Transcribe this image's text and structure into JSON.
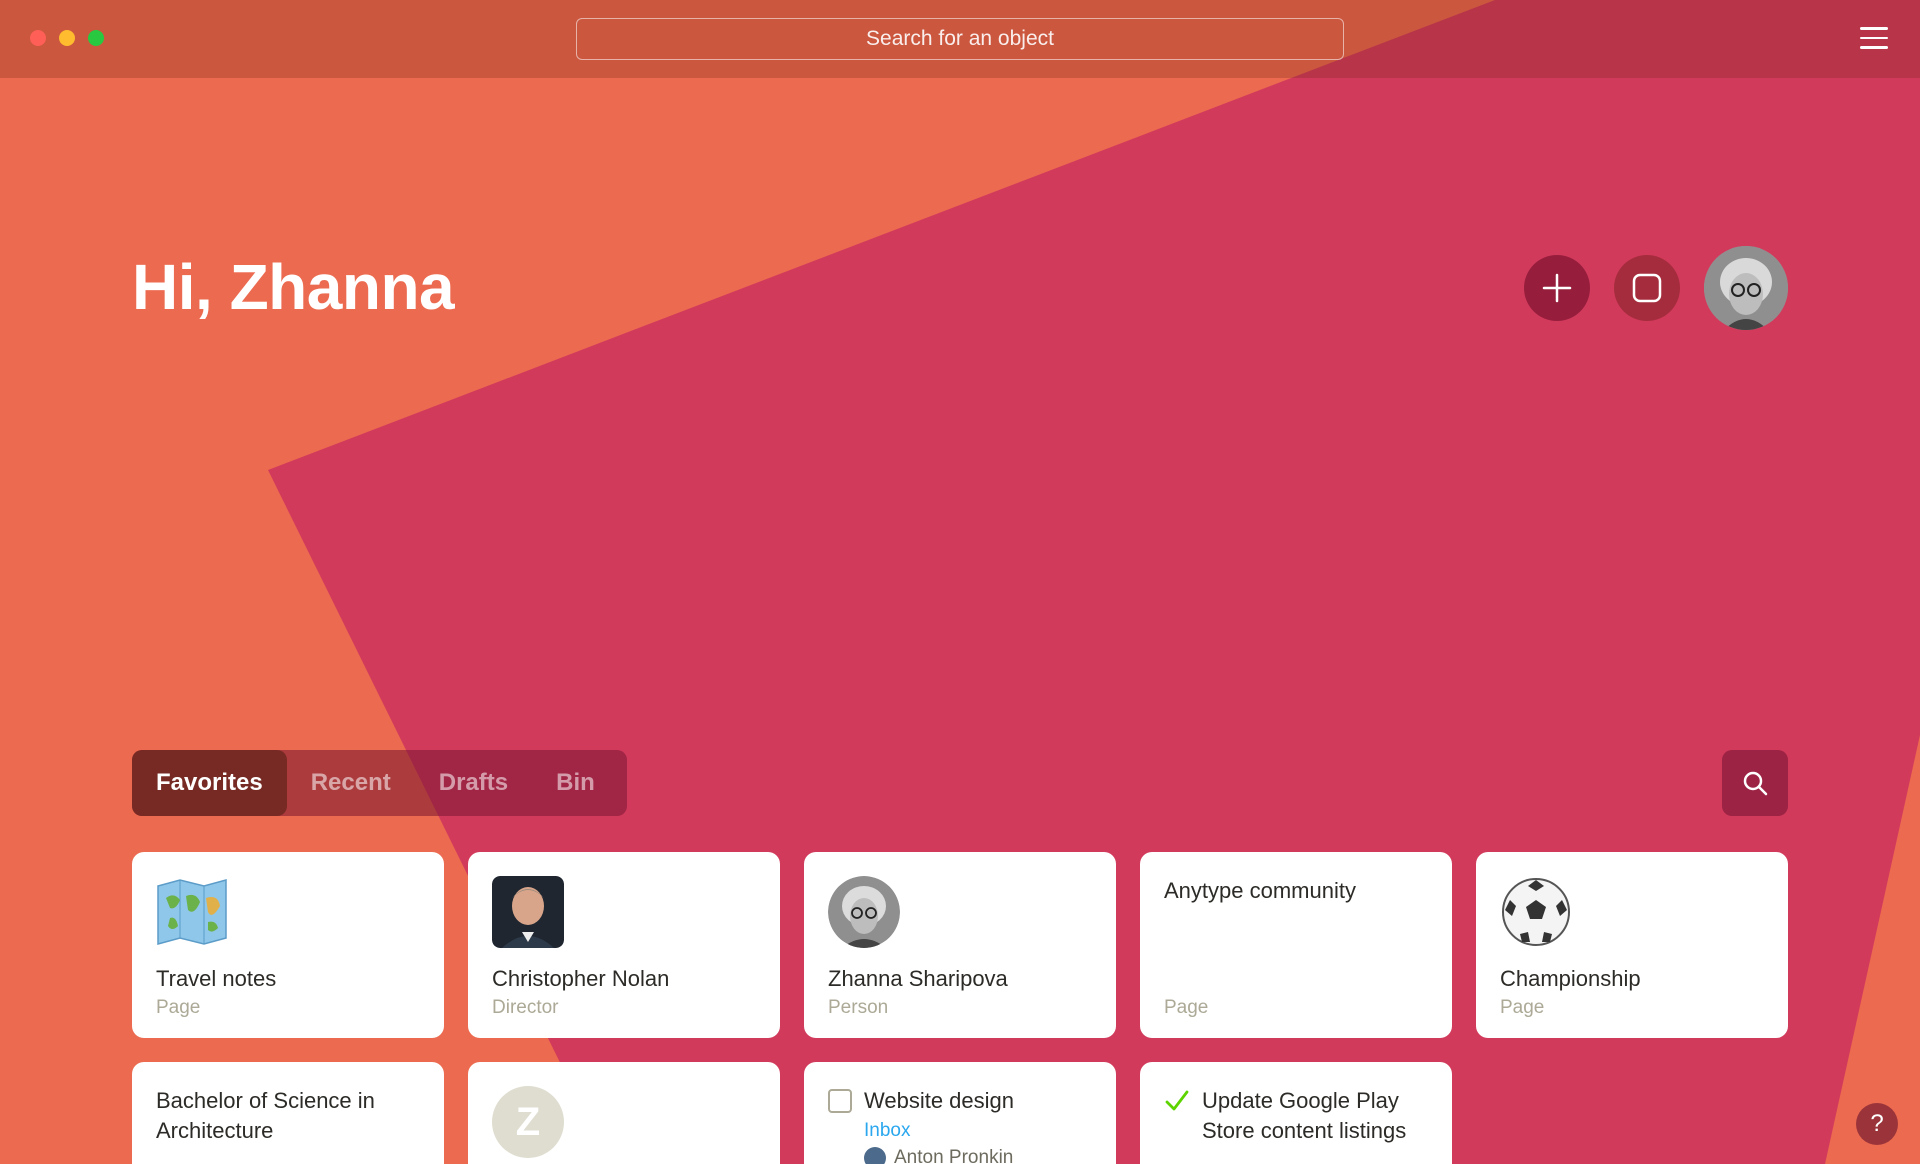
{
  "window": {
    "search_placeholder": "Search for an object"
  },
  "dashboard": {
    "greeting": "Hi, Zhanna"
  },
  "tabs": [
    {
      "label": "Favorites",
      "active": true
    },
    {
      "label": "Recent",
      "active": false
    },
    {
      "label": "Drafts",
      "active": false
    },
    {
      "label": "Bin",
      "active": false
    }
  ],
  "cards": [
    {
      "title": "Travel notes",
      "type": "Page",
      "icon": "world-map-icon"
    },
    {
      "title": "Christopher Nolan",
      "type": "Director",
      "icon": "person-photo"
    },
    {
      "title": "Zhanna Sharipova",
      "type": "Person",
      "icon": "person-photo"
    },
    {
      "title": "Anytype community",
      "type": "Page",
      "icon": ""
    },
    {
      "title": "Championship",
      "type": "Page",
      "icon": "soccer-ball-icon"
    },
    {
      "title": "Bachelor of Science in Architecture",
      "type": "",
      "icon": ""
    },
    {
      "title": "",
      "type": "",
      "icon": "letter-avatar",
      "letter": "Z"
    },
    {
      "title": "Website design",
      "type": "",
      "icon": "checkbox-icon",
      "status": "Inbox",
      "assignee": "Anton Pronkin"
    },
    {
      "title": "Update Google Play Store content listings",
      "type": "",
      "icon": "checkmark-icon"
    }
  ],
  "help": {
    "label": "?"
  },
  "colors": {
    "background": "#ec6a4f",
    "shape": "#d23a5c",
    "active_tab": "#772a23",
    "link": "#2aa7ee"
  }
}
